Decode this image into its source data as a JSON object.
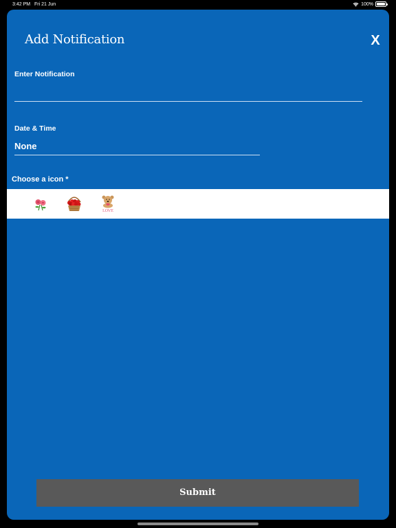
{
  "status_bar": {
    "time": "3:42 PM",
    "date": "Fri 21 Jun",
    "battery": "100%",
    "battery_level": 1.0,
    "wifi_icon": "wifi-icon",
    "battery_icon": "battery-icon"
  },
  "sheet": {
    "title": "Add Notification",
    "close_label": "X",
    "background_color": "#0a66b8"
  },
  "form": {
    "notification_label": "Enter Notification",
    "notification_value": "",
    "datetime_label": "Date & Time",
    "datetime_value": "None",
    "icon_label": "Choose a icon *",
    "icons": [
      "roses-icon",
      "rose-basket-icon",
      "teddy-bear-love-icon"
    ],
    "icon_caption_bear": "LOVE"
  },
  "submit": {
    "label": "Submit",
    "color": "#595959"
  }
}
